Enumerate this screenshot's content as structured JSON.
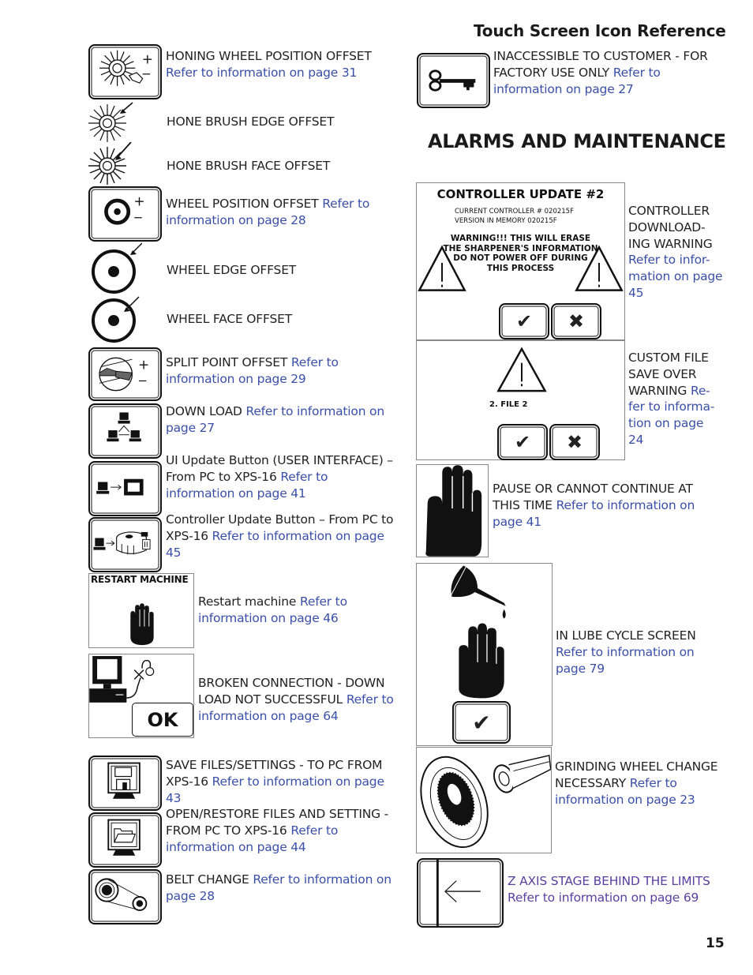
{
  "page": {
    "title": "Touch Screen Icon Reference",
    "section_heading": "ALARMS AND MAINTENANCE",
    "page_number": "15"
  },
  "colors": {
    "text": "#222222",
    "reference_link": "#3a4fa8",
    "reference_link_alt": "#5a3fa0"
  },
  "left_items": [
    {
      "icon": "honing-wheel-position-offset-icon",
      "label": "HONING WHEEL POSITION OFFSET",
      "ref": "Refer to information on page 31"
    },
    {
      "icon": "hone-brush-edge-offset-icon",
      "label": "HONE BRUSH EDGE OFFSET",
      "ref": ""
    },
    {
      "icon": "hone-brush-face-offset-icon",
      "label": "HONE BRUSH FACE OFFSET",
      "ref": ""
    },
    {
      "icon": "wheel-position-offset-icon",
      "label": "WHEEL POSITION OFFSET",
      "ref": "Refer to information on page 28"
    },
    {
      "icon": "wheel-edge-offset-icon",
      "label": "WHEEL EDGE OFFSET",
      "ref": ""
    },
    {
      "icon": "wheel-face-offset-icon",
      "label": "WHEEL FACE OFFSET",
      "ref": ""
    },
    {
      "icon": "split-point-offset-icon",
      "label": "SPLIT POINT OFFSET",
      "ref": "Refer to information on page 29"
    },
    {
      "icon": "download-network-icon",
      "label": "DOWN LOAD",
      "ref": "Refer to information on page 27"
    },
    {
      "icon": "ui-update-icon",
      "label": "UI Update Button (USER INTERFACE) – From PC to XPS-16",
      "ref": "Refer to information on page 41"
    },
    {
      "icon": "controller-update-icon",
      "label": "Controller Update Button – From PC to XPS-16",
      "ref": "Refer to information on page 45"
    },
    {
      "icon": "restart-machine-screen-icon",
      "label": "Restart machine",
      "ref": "Refer to information on page 46",
      "screen_title": "RESTART MACHINE"
    },
    {
      "icon": "broken-connection-icon",
      "label": "BROKEN CONNECTION - DOWN LOAD NOT SUCCESSFUL",
      "ref": "Refer to information on page 64",
      "button": "OK"
    },
    {
      "icon": "save-files-icon",
      "label": "SAVE FILES/SETTINGS - TO PC FROM XPS-16",
      "ref": "Refer to information on page 43"
    },
    {
      "icon": "open-restore-files-icon",
      "label": "OPEN/RESTORE FILES AND SETTING - FROM PC TO XPS-16",
      "ref": "Refer to information on page 44"
    },
    {
      "icon": "belt-change-icon",
      "label": "BELT CHANGE",
      "ref": "Refer to information on page 28"
    }
  ],
  "right_items": [
    {
      "icon": "key-icon",
      "label": "INACCESSIBLE TO CUSTOMER - FOR FACTORY USE ONLY",
      "ref": "Refer to information on page 27"
    },
    {
      "icon": "controller-update-warning-screen",
      "label": "CONTROLLER DOWNLOADING WARNING",
      "ref": "Refer to information on page 45",
      "screen": {
        "title": "CONTROLLER UPDATE #2",
        "line1": "CURRENT CONTROLLER # 020215F",
        "line2": "VERSION IN MEMORY  020215F",
        "warning": [
          "WARNING!!! THIS WILL ERASE",
          "THE SHARPENER'S INFORMATION",
          "DO NOT POWER OFF DURING",
          "THIS PROCESS"
        ]
      }
    },
    {
      "icon": "custom-file-save-warning-screen",
      "label": "CUSTOM FILE SAVE OVER WARNING",
      "ref": "Refer to information on page 24",
      "screen": {
        "file": "2.   FILE 2"
      }
    },
    {
      "icon": "stop-hand-icon",
      "label": "PAUSE OR CANNOT CONTINUE AT THIS TIME",
      "ref": "Refer to information on page 41"
    },
    {
      "icon": "lube-cycle-screen",
      "label": "IN LUBE CYCLE SCREEN",
      "ref": "Refer to information on page 79"
    },
    {
      "icon": "grinding-wheel-icon",
      "label": "GRINDING WHEEL CHANGE NECESSARY",
      "ref": "Refer to information on page 23"
    },
    {
      "icon": "z-axis-arrow-icon",
      "label": "Z AXIS STAGE BEHIND THE LIMITS",
      "ref": "Refer to information on page 69"
    }
  ]
}
